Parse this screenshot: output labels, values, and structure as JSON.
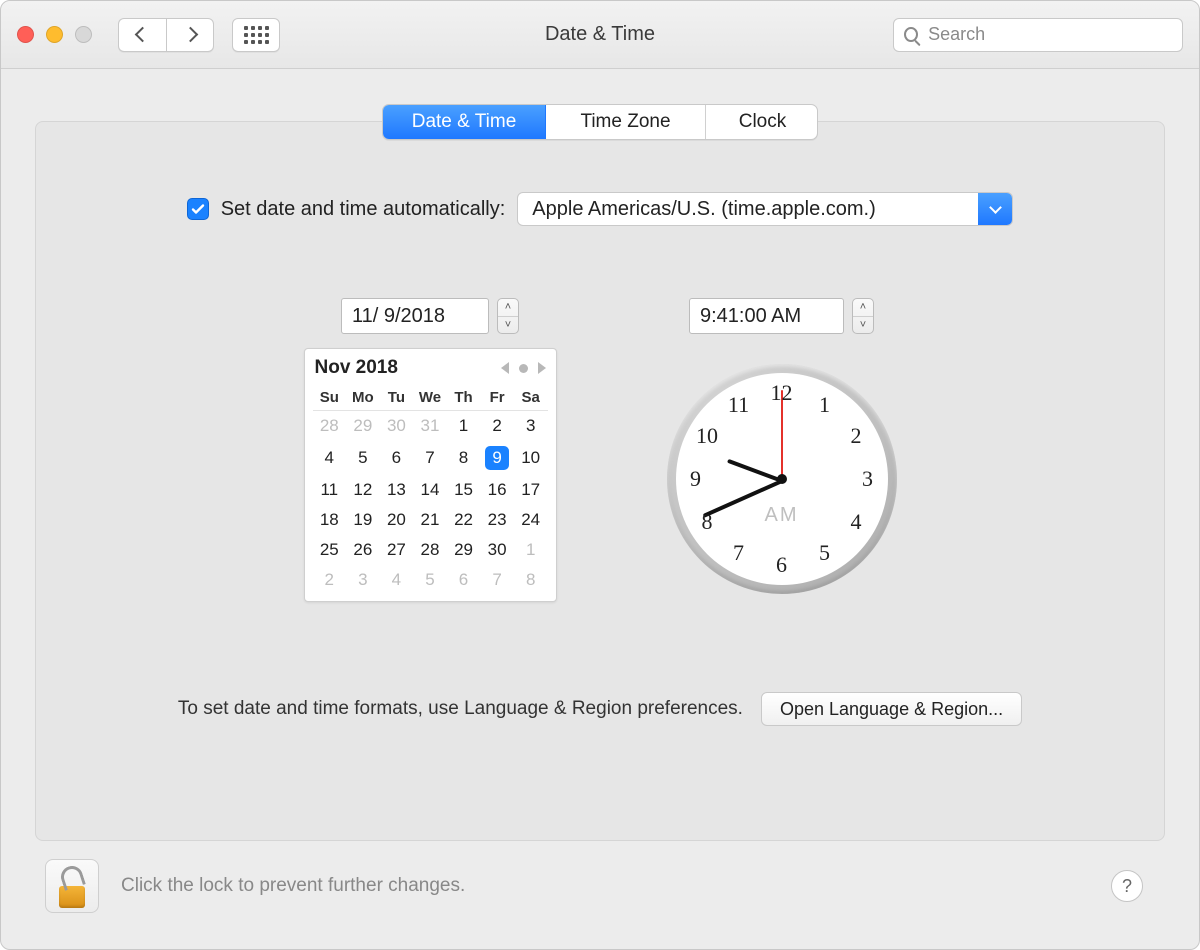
{
  "window": {
    "title": "Date & Time"
  },
  "search": {
    "placeholder": "Search"
  },
  "tabs": {
    "date_time": "Date & Time",
    "time_zone": "Time Zone",
    "clock": "Clock"
  },
  "auto": {
    "label": "Set date and time automatically:",
    "server": "Apple Americas/U.S. (time.apple.com.)",
    "checked": true
  },
  "date_field": "11/ 9/2018",
  "time_field": "9:41:00 AM",
  "calendar": {
    "title": "Nov 2018",
    "dow": [
      "Su",
      "Mo",
      "Tu",
      "We",
      "Th",
      "Fr",
      "Sa"
    ],
    "rows": [
      [
        {
          "d": "28",
          "o": 1
        },
        {
          "d": "29",
          "o": 1
        },
        {
          "d": "30",
          "o": 1
        },
        {
          "d": "31",
          "o": 1
        },
        {
          "d": "1"
        },
        {
          "d": "2"
        },
        {
          "d": "3"
        }
      ],
      [
        {
          "d": "4"
        },
        {
          "d": "5"
        },
        {
          "d": "6"
        },
        {
          "d": "7"
        },
        {
          "d": "8"
        },
        {
          "d": "9",
          "sel": 1
        },
        {
          "d": "10"
        }
      ],
      [
        {
          "d": "11"
        },
        {
          "d": "12"
        },
        {
          "d": "13"
        },
        {
          "d": "14"
        },
        {
          "d": "15"
        },
        {
          "d": "16"
        },
        {
          "d": "17"
        }
      ],
      [
        {
          "d": "18"
        },
        {
          "d": "19"
        },
        {
          "d": "20"
        },
        {
          "d": "21"
        },
        {
          "d": "22"
        },
        {
          "d": "23"
        },
        {
          "d": "24"
        }
      ],
      [
        {
          "d": "25"
        },
        {
          "d": "26"
        },
        {
          "d": "27"
        },
        {
          "d": "28"
        },
        {
          "d": "29"
        },
        {
          "d": "30"
        },
        {
          "d": "1",
          "o": 1
        }
      ],
      [
        {
          "d": "2",
          "o": 1
        },
        {
          "d": "3",
          "o": 1
        },
        {
          "d": "4",
          "o": 1
        },
        {
          "d": "5",
          "o": 1
        },
        {
          "d": "6",
          "o": 1
        },
        {
          "d": "7",
          "o": 1
        },
        {
          "d": "8",
          "o": 1
        }
      ]
    ]
  },
  "clock": {
    "ampm": "AM",
    "hour_angle": 200.5,
    "minute_angle": 156,
    "second_angle": -90,
    "numerals": [
      "12",
      "1",
      "2",
      "3",
      "4",
      "5",
      "6",
      "7",
      "8",
      "9",
      "10",
      "11"
    ]
  },
  "hint": "To set date and time formats, use Language & Region preferences.",
  "open_lang_region": "Open Language & Region...",
  "footer": {
    "lock_hint": "Click the lock to prevent further changes.",
    "help": "?"
  }
}
